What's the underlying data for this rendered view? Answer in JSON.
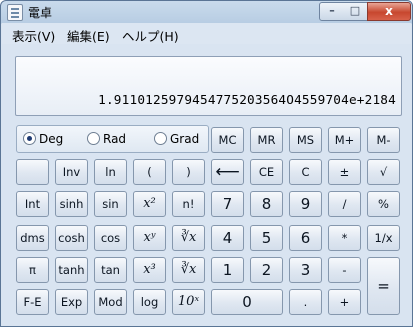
{
  "window": {
    "title": "電卓",
    "controls": {
      "minimize": "–",
      "maximize": "□",
      "close": "x"
    }
  },
  "menu": [
    "表示(V)",
    "編集(E)",
    "ヘルプ(H)"
  ],
  "display": {
    "value": "1.9110125979454775203564O4559704e+2184"
  },
  "mode": {
    "options": [
      "Deg",
      "Rad",
      "Grad"
    ],
    "selected": "Deg"
  },
  "keys": {
    "mc": "MC",
    "mr": "MR",
    "ms": "MS",
    "mplus": "M+",
    "mminus": "M-",
    "inv": "Inv",
    "ln": "ln",
    "lparen": "(",
    "rparen": ")",
    "backspace": "⟵",
    "ce": "CE",
    "c": "C",
    "plusminus": "±",
    "sqrt": "√",
    "int": "Int",
    "sinh": "sinh",
    "sin": "sin",
    "sq": "x²",
    "fact": "n!",
    "n7": "7",
    "n8": "8",
    "n9": "9",
    "div": "/",
    "pct": "%",
    "dms": "dms",
    "cosh": "cosh",
    "cos": "cos",
    "pow": "xʸ",
    "yroot": "∛x",
    "n4": "4",
    "n5": "5",
    "n6": "6",
    "mul": "*",
    "recip": "1/x",
    "pi": "π",
    "tanh": "tanh",
    "tan": "tan",
    "cube": "x³",
    "croot": "∛x",
    "n1": "1",
    "n2": "2",
    "n3": "3",
    "sub": "-",
    "eq": "=",
    "fe": "F-E",
    "exp": "Exp",
    "mod": "Mod",
    "log": "log",
    "tenx": "10ˣ",
    "n0": "0",
    "dot": ".",
    "add": "+"
  }
}
